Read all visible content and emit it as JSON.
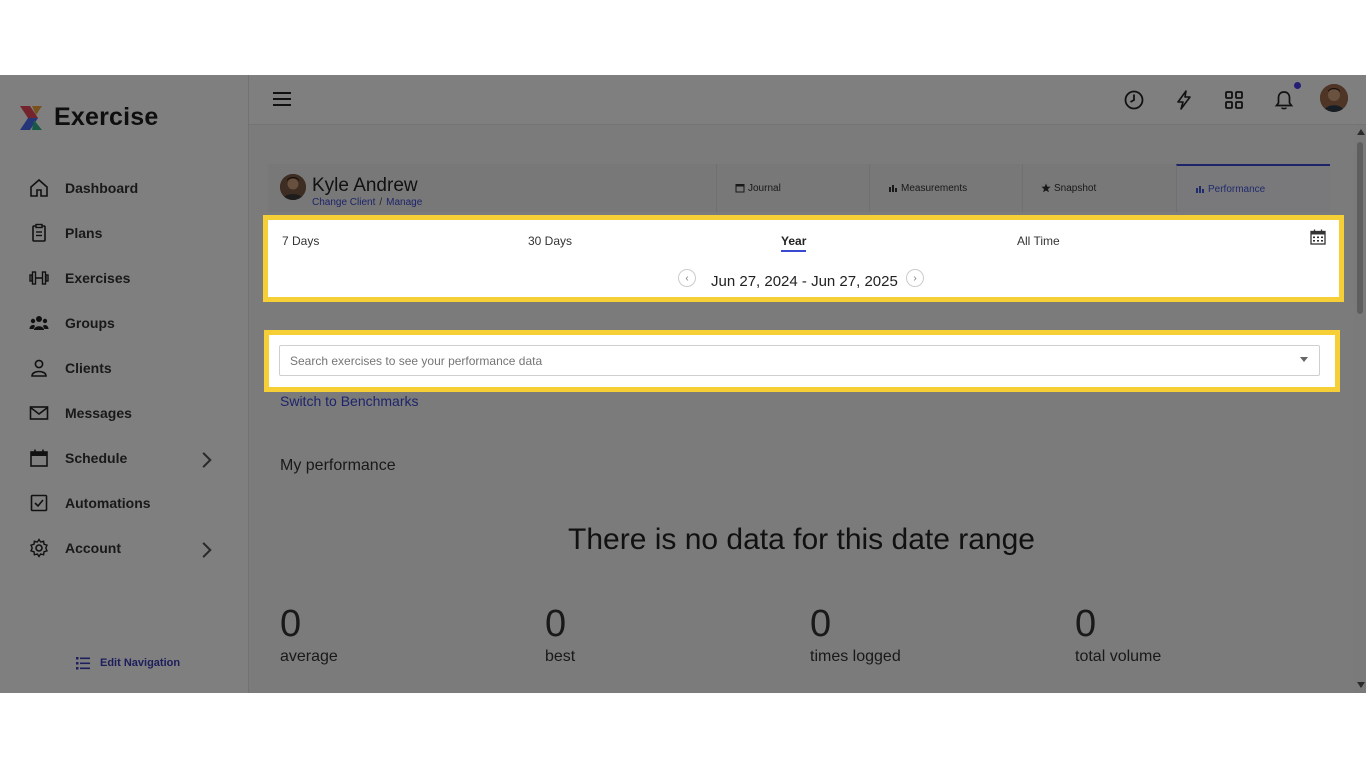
{
  "app": {
    "name": "Exercise"
  },
  "sidebar": {
    "items": [
      {
        "label": "Dashboard",
        "icon": "home-icon"
      },
      {
        "label": "Plans",
        "icon": "clipboard-icon"
      },
      {
        "label": "Exercises",
        "icon": "dumbbell-icon"
      },
      {
        "label": "Groups",
        "icon": "users-icon"
      },
      {
        "label": "Clients",
        "icon": "user-icon"
      },
      {
        "label": "Messages",
        "icon": "envelope-icon"
      },
      {
        "label": "Schedule",
        "icon": "calendar-icon"
      },
      {
        "label": "Automations",
        "icon": "checkbox-icon"
      },
      {
        "label": "Account",
        "icon": "gear-icon"
      }
    ],
    "edit_nav_label": "Edit Navigation"
  },
  "client": {
    "name": "Kyle Andrew",
    "change_label": "Change Client",
    "separator": "/",
    "manage_label": "Manage"
  },
  "tabs": [
    {
      "label": "Journal",
      "icon": "journal-icon"
    },
    {
      "label": "Measurements",
      "icon": "bar-chart-icon"
    },
    {
      "label": "Snapshot",
      "icon": "star-icon"
    },
    {
      "label": "Performance",
      "icon": "bar-chart-icon",
      "active": true
    }
  ],
  "range": {
    "options": [
      "7 Days",
      "30 Days",
      "Year",
      "All Time"
    ],
    "active": "Year",
    "prev": "‹",
    "next": "›",
    "label": "Jun 27, 2024 - Jun 27, 2025"
  },
  "search": {
    "placeholder": "Search exercises to see your performance data"
  },
  "switch_label": "Switch to Benchmarks",
  "performance": {
    "title": "My performance",
    "empty_message": "There is no data for this date range",
    "stats": [
      {
        "value": "0",
        "label": "average"
      },
      {
        "value": "0",
        "label": "best"
      },
      {
        "value": "0",
        "label": "times logged"
      },
      {
        "value": "0",
        "label": "total volume"
      }
    ]
  },
  "colors": {
    "accent": "#3a4ad0",
    "highlight": "#f6cf37",
    "notification_dot": "#4a3ee8"
  }
}
